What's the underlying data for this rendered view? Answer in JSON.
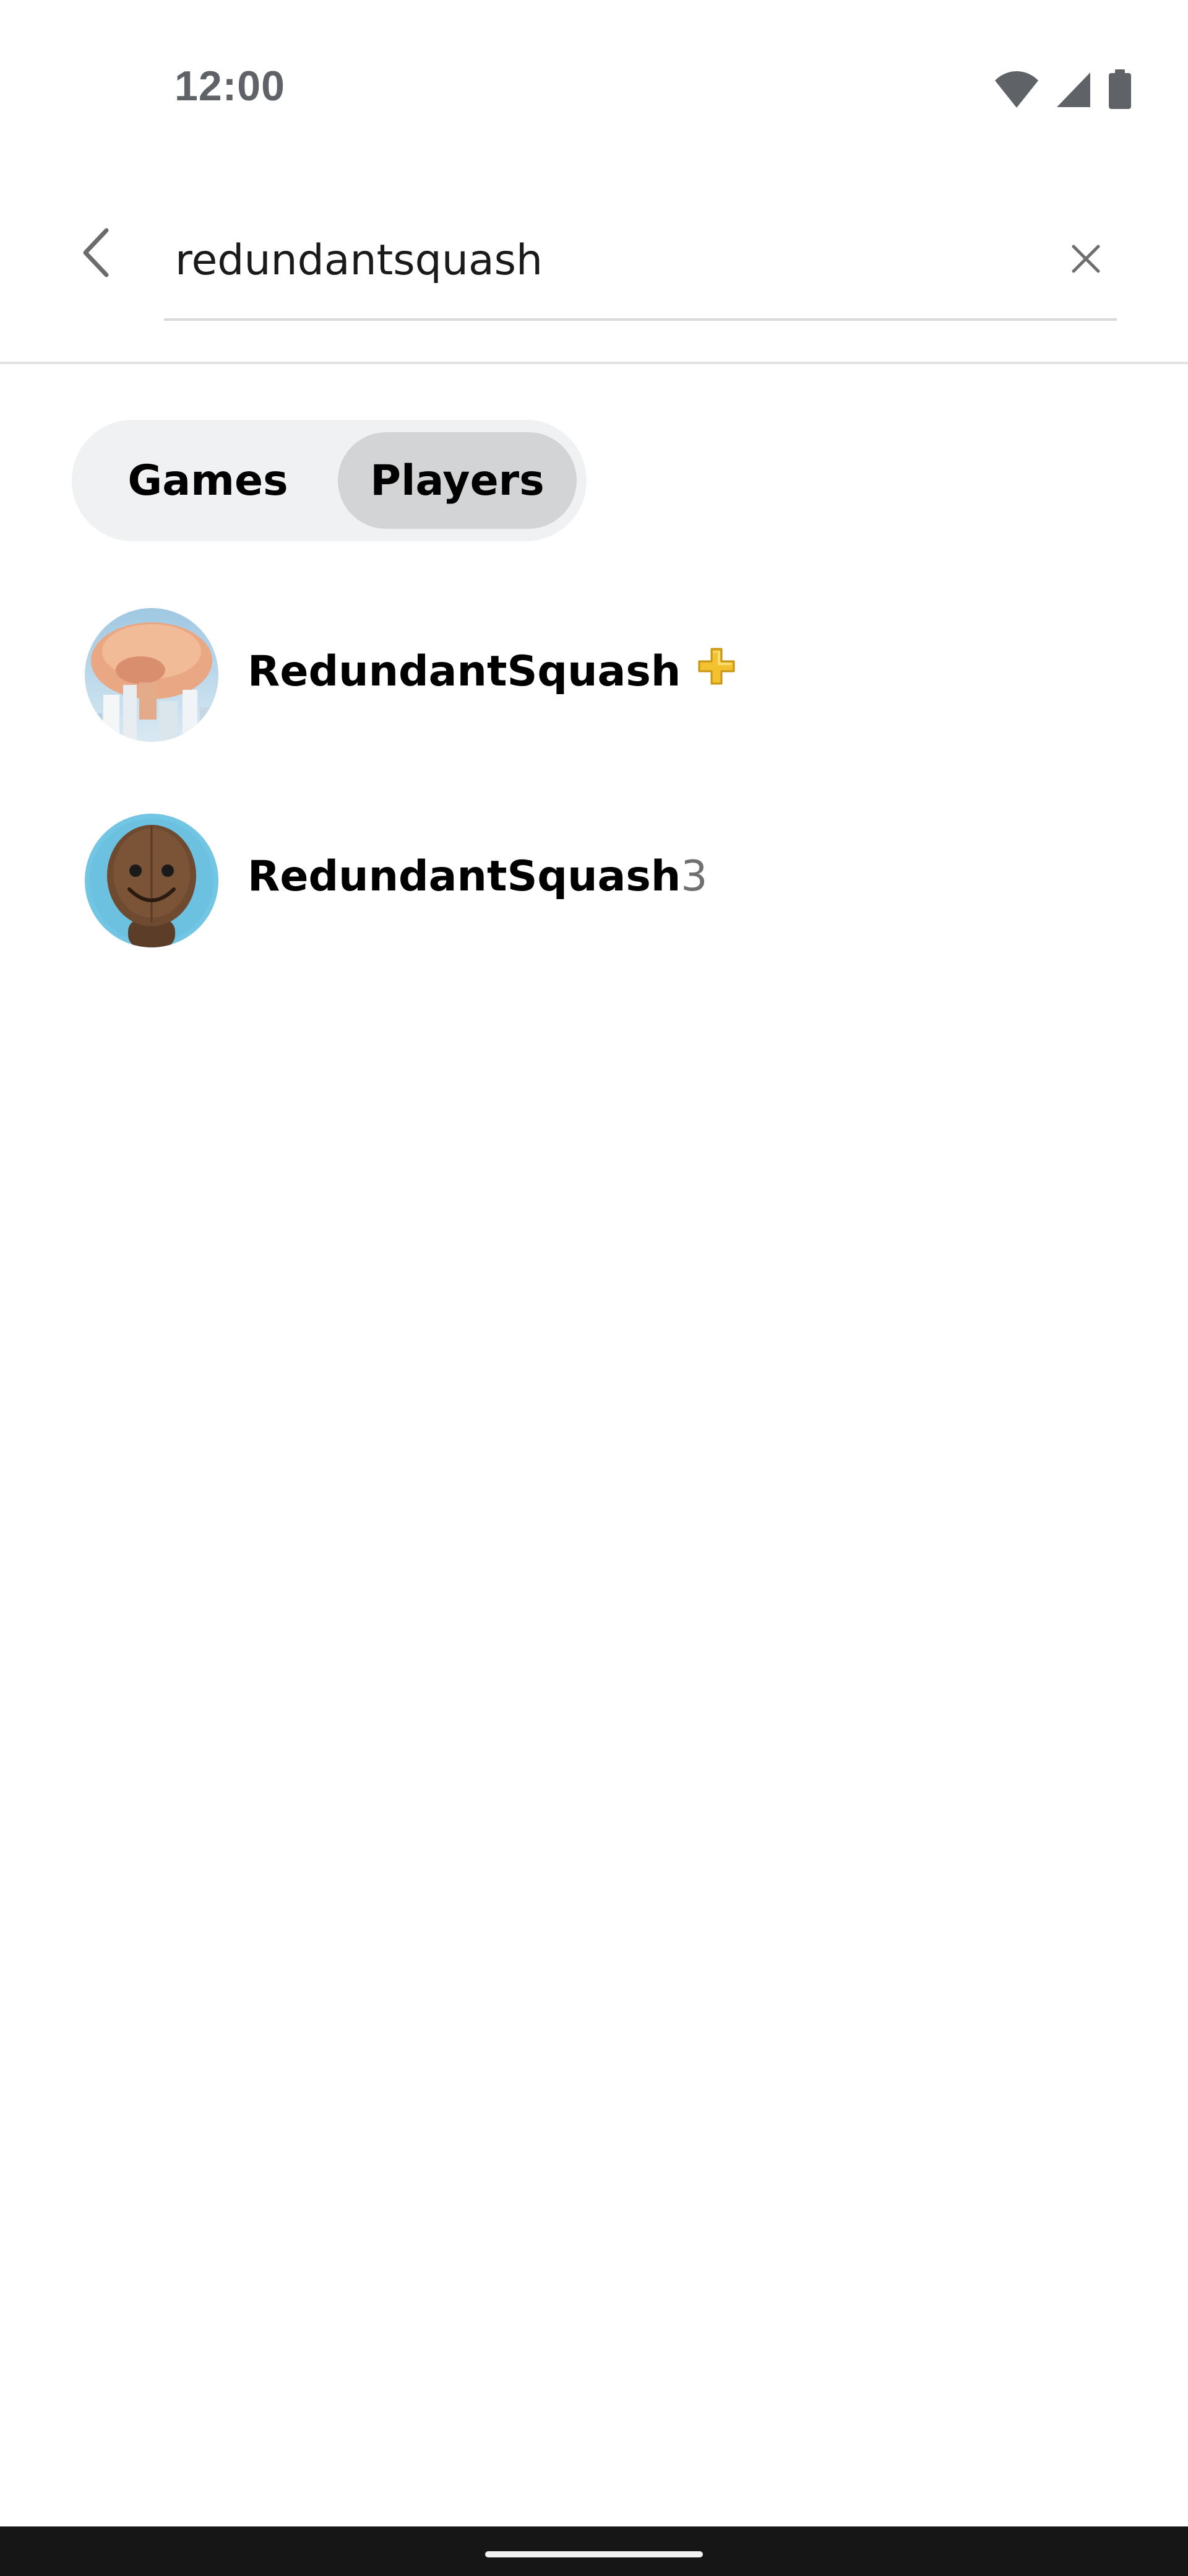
{
  "status_bar": {
    "time": "12:00",
    "icons": [
      "wifi-icon",
      "cell-signal-icon",
      "battery-icon"
    ]
  },
  "search": {
    "query": "redundantsquash",
    "back_icon": "chevron-left-icon",
    "clear_icon": "close-icon"
  },
  "tabs": [
    {
      "label": "Games",
      "selected": false
    },
    {
      "label": "Players",
      "selected": true
    }
  ],
  "results": [
    {
      "name": "RedundantSquash",
      "suffix": "",
      "badge": "playstation-plus-icon",
      "avatar": "mushroom-cloud-city-avatar"
    },
    {
      "name": "RedundantSquash",
      "suffix": "3",
      "badge": "",
      "avatar": "sackboy-avatar"
    }
  ],
  "colors": {
    "selected_tab": "#d3d4d6",
    "tab_track": "#f0f1f2",
    "plus_badge": "#f2c230",
    "nav_bar": "#161616"
  }
}
